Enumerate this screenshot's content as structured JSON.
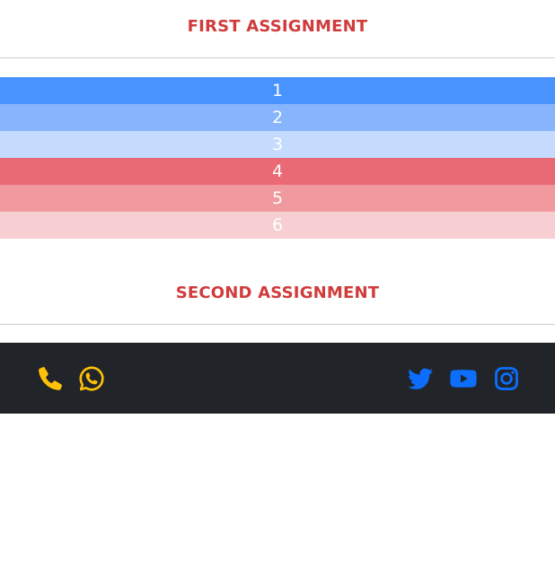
{
  "first_assignment": {
    "title": "FIRST ASSIGNMENT",
    "stripes": [
      {
        "label": "1",
        "color": "#4893fd"
      },
      {
        "label": "2",
        "color": "#86b4fd"
      },
      {
        "label": "3",
        "color": "#c4dbfe"
      },
      {
        "label": "4",
        "color": "#e96a75"
      },
      {
        "label": "5",
        "color": "#f09a9f"
      },
      {
        "label": "6",
        "color": "#f7cfd3"
      }
    ]
  },
  "second_assignment": {
    "title": "SECOND ASSIGNMENT"
  },
  "footer": {
    "background": "#212529",
    "left_icons": [
      {
        "name": "phone-icon",
        "color": "#ffc107"
      },
      {
        "name": "whatsapp-icon",
        "color": "#ffc107"
      }
    ],
    "right_icons": [
      {
        "name": "twitter-icon",
        "color": "#0d6efd"
      },
      {
        "name": "youtube-icon",
        "color": "#0d6efd"
      },
      {
        "name": "instagram-icon",
        "color": "#0d6efd"
      }
    ]
  }
}
